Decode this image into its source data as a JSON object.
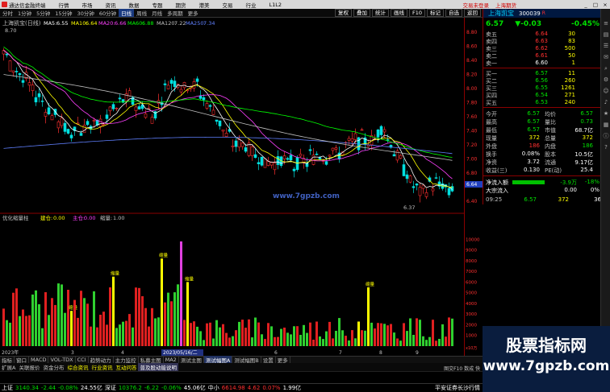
{
  "menubar": {
    "app_title": "通达信金融终端",
    "items": [
      "行情",
      "市场",
      "资讯",
      "数据",
      "专题",
      "期货",
      "港美",
      "交易",
      "行业",
      "L1L2"
    ],
    "alert_link": "交易未登录",
    "exchange_label": "上海期货",
    "window_buttons": [
      "_",
      "□",
      "×"
    ]
  },
  "periodbar": {
    "periods": [
      "分时",
      "1分钟",
      "5分钟",
      "15分钟",
      "30分钟",
      "60分钟",
      "日线",
      "周线",
      "月线",
      "多周期",
      "更多"
    ],
    "active": "日线",
    "tools": [
      "复权",
      "叠加",
      "统计",
      "画线",
      "F10",
      "标记",
      "自选",
      "返回"
    ]
  },
  "chart_header": {
    "stock_label": "上海凯宝(日线)",
    "ma_label": "MA5:",
    "ma5": "6.55",
    "ma10_label": "MA10:",
    "ma10": "6.64",
    "ma20_label": "MA20:",
    "ma20": "6.66",
    "ma60_label": "MA60:",
    "ma60": "6.88",
    "ma120_label": "MA120:",
    "ma120": "7.22",
    "ma250_label": "MA250:",
    "ma250": "7.34",
    "high_mark": "8.70",
    "low_mark": "6.37",
    "watermark": "www.7gpzb.com"
  },
  "indicator_header": {
    "name": "优化缩量柱",
    "l1_label": "建仓:",
    "l1": "0.00",
    "l2_label": "主仓:",
    "l2": "0.00",
    "l3_label": "缩量:",
    "l3": "1.00"
  },
  "price_axis": [
    "8.80",
    "8.60",
    "8.40",
    "8.20",
    "8.00",
    "7.80",
    "7.60",
    "7.40",
    "7.20",
    "7.00",
    "6.80",
    "6.64",
    "6.40"
  ],
  "vol_axis": [
    "10000",
    "9000",
    "8000",
    "7000",
    "6000",
    "5000",
    "4000",
    "3000",
    "2000",
    "1000"
  ],
  "vol_unit": "x10万",
  "axis_footer": "日线",
  "date_labels": {
    "year": "2023年",
    "sel": "2023/05/16/二",
    "months": [
      "3",
      "4",
      "5",
      "6",
      "7",
      "8",
      "9"
    ]
  },
  "chart_labels": {
    "band_label": "缩量"
  },
  "quote": {
    "name": "上海凯宝",
    "code": "300039",
    "code_flag": "R",
    "price": "6.57",
    "change": "▼-0.03",
    "pct": "-0.45%",
    "asks": [
      {
        "label": "卖五",
        "price": "6.64",
        "vol": "30"
      },
      {
        "label": "卖四",
        "price": "6.63",
        "vol": "83"
      },
      {
        "label": "卖三",
        "price": "6.62",
        "vol": "500"
      },
      {
        "label": "卖二",
        "price": "6.61",
        "vol": "50"
      },
      {
        "label": "卖一",
        "price": "6.60",
        "vol": "1"
      }
    ],
    "bids": [
      {
        "label": "买一",
        "price": "6.57",
        "vol": "11"
      },
      {
        "label": "买二",
        "price": "6.56",
        "vol": "260"
      },
      {
        "label": "买三",
        "price": "6.55",
        "vol": "1261"
      },
      {
        "label": "买四",
        "price": "6.54",
        "vol": "271"
      },
      {
        "label": "买五",
        "price": "6.53",
        "vol": "240"
      }
    ],
    "stats": [
      {
        "l": "今开",
        "v": "6.57",
        "l2": "均价",
        "v2": "6.57"
      },
      {
        "l": "最高",
        "v": "6.57",
        "l2": "量比",
        "v2": "0.73"
      },
      {
        "l": "最低",
        "v": "6.57",
        "l2": "市值",
        "v2": "68.7亿"
      },
      {
        "l": "现量",
        "v": "372",
        "l2": "总量",
        "v2": "372"
      },
      {
        "l": "外盘",
        "v": "186",
        "l2": "内盘",
        "v2": "186"
      },
      {
        "l": "换手",
        "v": "0.08%",
        "l2": "股本",
        "v2": "10.5亿"
      },
      {
        "l": "净资",
        "v": "3.72",
        "l2": "流通",
        "v2": "9.17亿"
      },
      {
        "l": "收益(三)",
        "v": "0.130",
        "l2": "PE(动)",
        "v2": "25.4"
      }
    ],
    "flow1_label": "净流入额",
    "flow1_a": "-3.9万",
    "flow1_b": "-18%",
    "flow2_label": "大宗流入",
    "flow2_a": "0.00",
    "flow2_b": "0%",
    "tick_time": "09:25",
    "tick_price": "6.57",
    "tick_vol": "372",
    "tick_num": "36"
  },
  "tabs1": [
    "指标",
    "窗口",
    "MACD",
    "VOL-TDX",
    "CCI",
    "趋势动力",
    "主力监控",
    "私募主图",
    "MA2",
    "测试主图",
    "测试幅图A",
    "测试幅图B",
    "设置",
    "更多"
  ],
  "tabs1_active": "测试幅图A",
  "tabs2": [
    "扩展A",
    "关联报价",
    "资金分布",
    "综合资讯",
    "行业资讯",
    "互动问答",
    "普及股动能说明"
  ],
  "tabs2_hl": [
    "综合资讯",
    "行业资讯",
    "互动问答"
  ],
  "tabs2_active": "普及股动能说明",
  "status": {
    "sh_label": "上证",
    "sh_val": "3140.34",
    "sh_chg": "-2.44",
    "sh_pct": "-0.08%",
    "sh_amt": "24.55亿",
    "sz_label": "深证",
    "sz_val": "10376.2",
    "sz_chg": "-6.22",
    "sz_pct": "-0.06%",
    "sz_amt": "45.06亿",
    "zx_label": "中小",
    "zx_val": "6614.98",
    "zx_chg": "4.62",
    "zx_pct": "0.07%",
    "zx_amt": "1.99亿",
    "broker": "平安证券长沙行情"
  },
  "wm_line1": "股票指标网",
  "wm_line2": "www.7gpzb.com",
  "tab_right_label": "图交F10 数成 快",
  "sidebar_icons": [
    "menu-icon",
    "chart-icon",
    "list-icon",
    "news-icon",
    "search-icon",
    "gear-icon",
    "user-icon",
    "bell-icon",
    "star-icon",
    "grid-icon",
    "info-icon",
    "help-icon"
  ],
  "colors": {
    "up": "#ff3030",
    "down": "#00e0e0",
    "ma5": "#ffffff",
    "ma10": "#ffff00",
    "ma20": "#ff40ff",
    "ma60": "#00ff00",
    "ma120": "#6080ff",
    "ma250": "#c0c0c0",
    "vol_red": "#e02020",
    "vol_green": "#30d030",
    "vol_yellow": "#ffff00",
    "vol_magenta": "#e040e0"
  }
}
